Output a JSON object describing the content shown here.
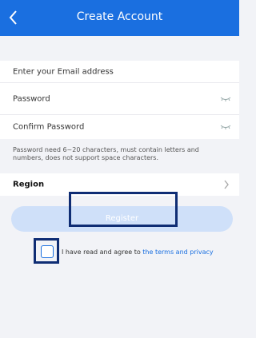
{
  "header": {
    "title": "Create Account",
    "icons": {
      "back": "chevron-left-icon"
    }
  },
  "form": {
    "email_placeholder": "Enter your Email address",
    "password_placeholder": "Password",
    "confirm_placeholder": "Confirm Password",
    "hint": "Password need 6~20 characters, must contain letters and numbers, does not support space characters.",
    "region_label": "Region"
  },
  "actions": {
    "register_label": "Register"
  },
  "terms": {
    "prefix": "I have read and agree to ",
    "link": "the terms and privacy"
  },
  "colors": {
    "accent": "#1a6fe0",
    "register_disabled": "#cfe0f9",
    "highlight_box": "#0f2d74"
  }
}
